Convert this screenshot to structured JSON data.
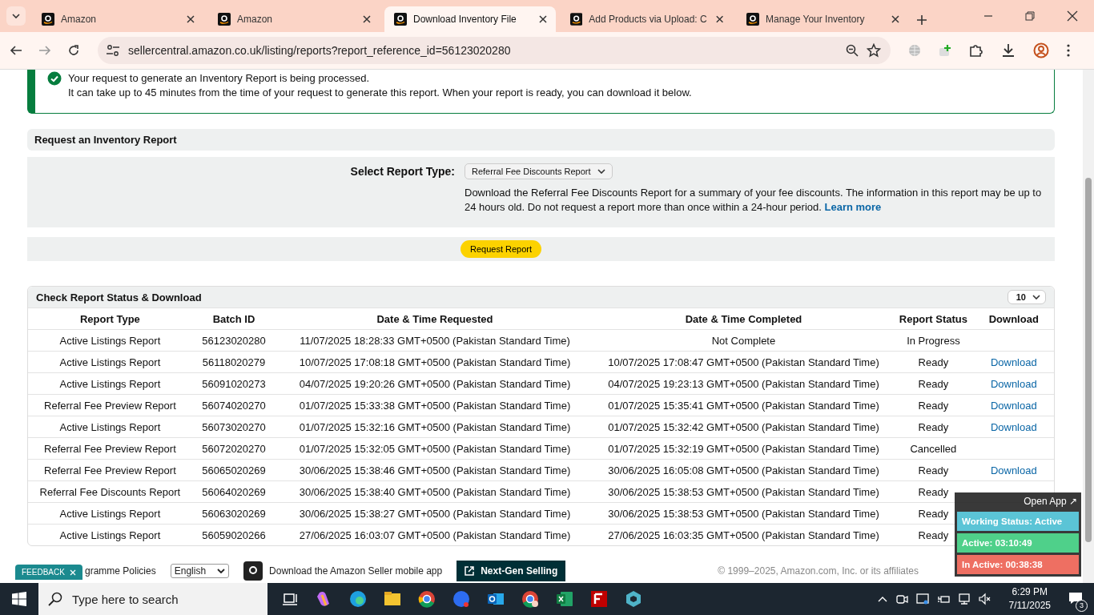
{
  "browser": {
    "tabs": [
      {
        "title": "Amazon",
        "selected": false
      },
      {
        "title": "Amazon",
        "selected": false
      },
      {
        "title": "Download Inventory File",
        "selected": true
      },
      {
        "title": "Add Products via Upload: C",
        "selected": false
      },
      {
        "title": "Manage Your Inventory",
        "selected": false
      }
    ],
    "address": "sellercentral.amazon.co.uk/listing/reports?report_reference_id=56123020280"
  },
  "alert": {
    "lines": [
      "Your request to generate an Inventory Report is being processed.",
      "It can take up to 45 minutes from the time of your request to generate this report. When your report is ready, you can download it below."
    ]
  },
  "request_section": {
    "title": "Request an Inventory Report",
    "select_label": "Select Report Type:",
    "select_value": "Referral Fee Discounts Report",
    "description": "Download the Referral Fee Discounts Report for a summary of your fee discounts. The information in this report may be up to 24 hours old. Do not request a report more than once within a 24-hour period.",
    "learn_more": "Learn more",
    "button": "Request Report"
  },
  "status_section": {
    "title": "Check Report Status & Download",
    "page_size": "10",
    "columns": [
      "Report Type",
      "Batch ID",
      "Date & Time Requested",
      "Date & Time Completed",
      "Report Status",
      "Download"
    ],
    "rows": [
      {
        "report_type": "Active Listings Report",
        "batch_id": "56123020280",
        "requested": "11/07/2025 18:28:33 GMT+0500 (Pakistan Standard Time)",
        "completed": "Not Complete",
        "status": "In Progress"
      },
      {
        "report_type": "Active Listings Report",
        "batch_id": "56118020279",
        "requested": "10/07/2025 17:08:18 GMT+0500 (Pakistan Standard Time)",
        "completed": "10/07/2025 17:08:47 GMT+0500 (Pakistan Standard Time)",
        "status": "Ready",
        "download": "Download"
      },
      {
        "report_type": "Active Listings Report",
        "batch_id": "56091020273",
        "requested": "04/07/2025 19:20:26 GMT+0500 (Pakistan Standard Time)",
        "completed": "04/07/2025 19:23:13 GMT+0500 (Pakistan Standard Time)",
        "status": "Ready",
        "download": "Download"
      },
      {
        "report_type": "Referral Fee Preview Report",
        "batch_id": "56074020270",
        "requested": "01/07/2025 15:33:38 GMT+0500 (Pakistan Standard Time)",
        "completed": "01/07/2025 15:35:41 GMT+0500 (Pakistan Standard Time)",
        "status": "Ready",
        "download": "Download"
      },
      {
        "report_type": "Active Listings Report",
        "batch_id": "56073020270",
        "requested": "01/07/2025 15:32:16 GMT+0500 (Pakistan Standard Time)",
        "completed": "01/07/2025 15:32:42 GMT+0500 (Pakistan Standard Time)",
        "status": "Ready",
        "download": "Download"
      },
      {
        "report_type": "Referral Fee Preview Report",
        "batch_id": "56072020270",
        "requested": "01/07/2025 15:32:05 GMT+0500 (Pakistan Standard Time)",
        "completed": "01/07/2025 15:32:19 GMT+0500 (Pakistan Standard Time)",
        "status": "Cancelled"
      },
      {
        "report_type": "Referral Fee Preview Report",
        "batch_id": "56065020269",
        "requested": "30/06/2025 15:38:46 GMT+0500 (Pakistan Standard Time)",
        "completed": "30/06/2025 16:05:08 GMT+0500 (Pakistan Standard Time)",
        "status": "Ready",
        "download": "Download"
      },
      {
        "report_type": "Referral Fee Discounts Report",
        "batch_id": "56064020269",
        "requested": "30/06/2025 15:38:40 GMT+0500 (Pakistan Standard Time)",
        "completed": "30/06/2025 15:38:53 GMT+0500 (Pakistan Standard Time)",
        "status": "Ready"
      },
      {
        "report_type": "Active Listings Report",
        "batch_id": "56063020269",
        "requested": "30/06/2025 15:38:27 GMT+0500 (Pakistan Standard Time)",
        "completed": "30/06/2025 15:38:53 GMT+0500 (Pakistan Standard Time)",
        "status": "Ready"
      },
      {
        "report_type": "Active Listings Report",
        "batch_id": "56059020266",
        "requested": "27/06/2025 16:03:07 GMT+0500 (Pakistan Standard Time)",
        "completed": "27/06/2025 16:03:35 GMT+0500 (Pakistan Standard Time)",
        "status": "Ready"
      }
    ]
  },
  "footer": {
    "feedback": "FEEDBACK",
    "policies": "gramme Policies",
    "language": "English",
    "app": "Download the Amazon Seller mobile app",
    "next_gen": "Next-Gen Selling",
    "copyright": "© 1999–2025, Amazon.com, Inc. or its affiliates"
  },
  "widget": {
    "open_app": "Open App ↗",
    "statuses": [
      {
        "label": "Working Status: Active",
        "color": "#5bc4d6"
      },
      {
        "label": "Active: 03:10:49",
        "color": "#4fd08a"
      },
      {
        "label": "In Active: 00:38:38",
        "color": "#ee6f62"
      }
    ]
  },
  "taskbar": {
    "search_placeholder": "Type here to search",
    "time": "6:29 PM",
    "date": "7/11/2025",
    "notifications": "3"
  }
}
